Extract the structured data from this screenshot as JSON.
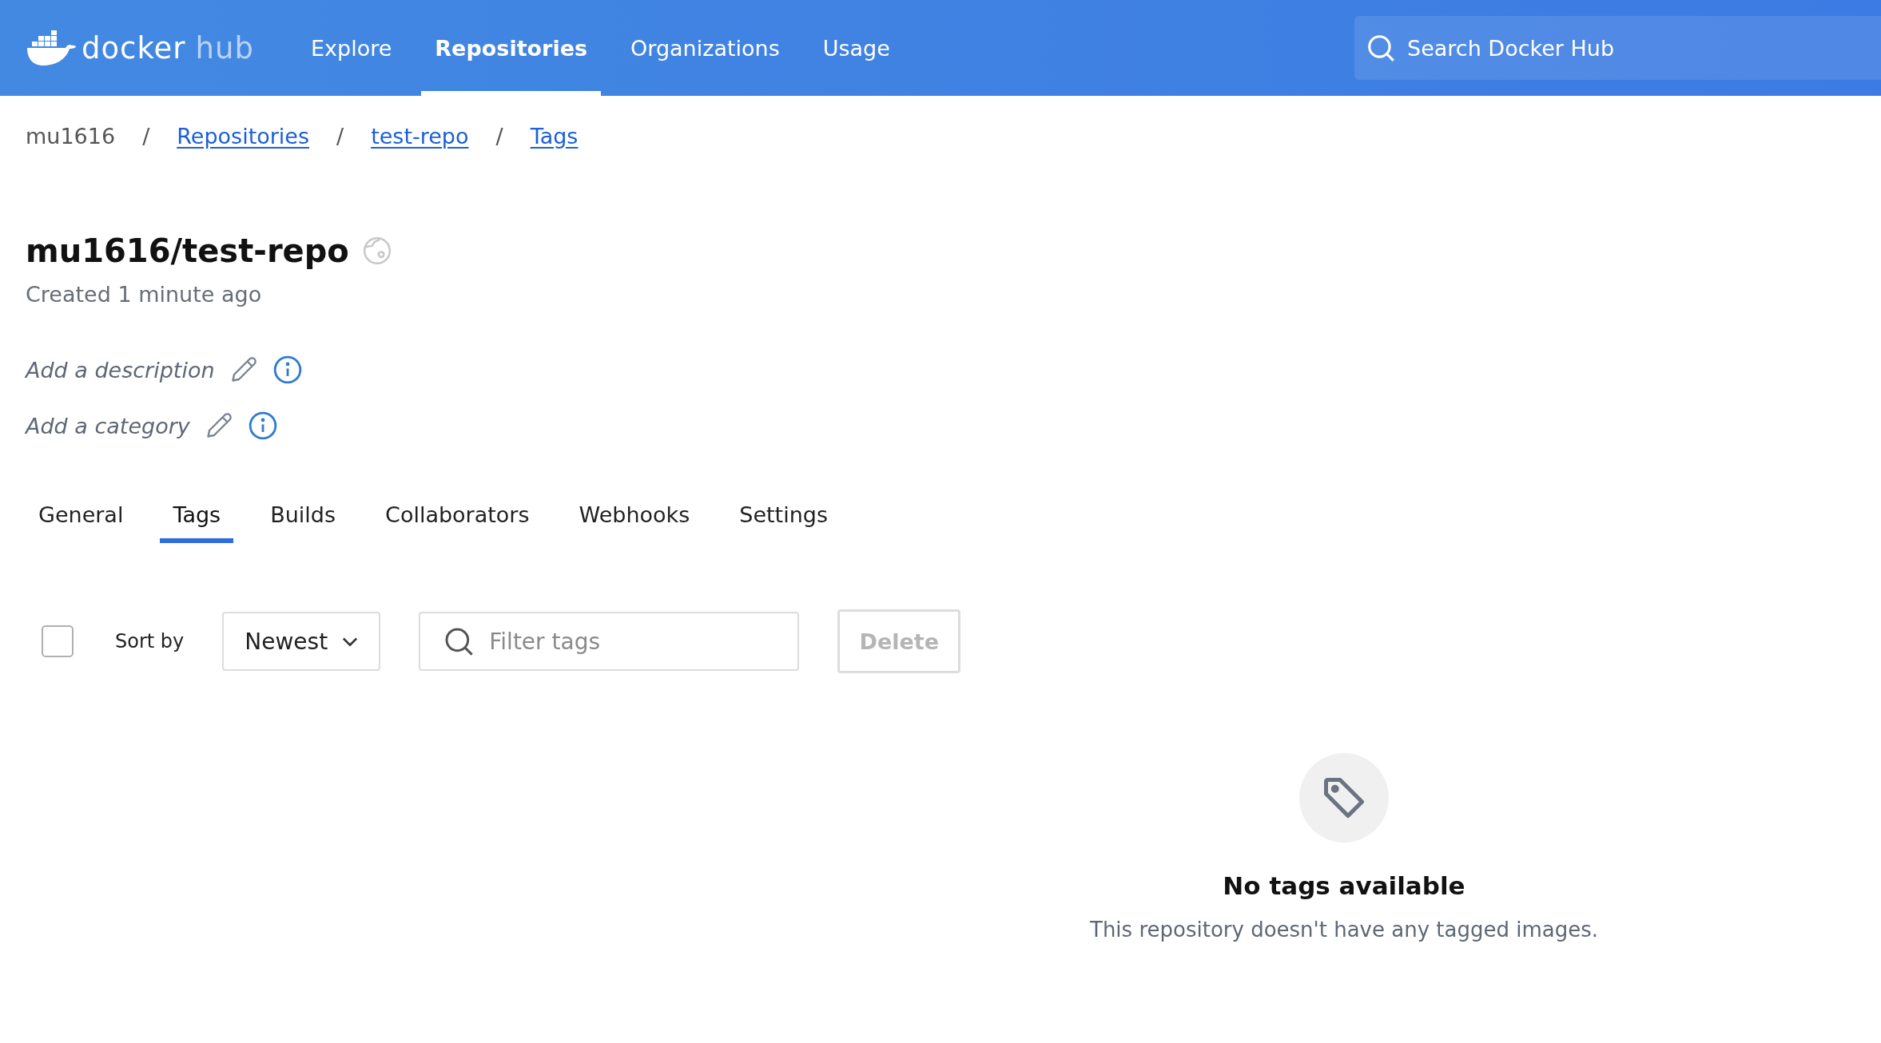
{
  "header": {
    "logo": {
      "primary": "docker",
      "secondary": "hub"
    },
    "nav": [
      {
        "label": "Explore",
        "selected": false
      },
      {
        "label": "Repositories",
        "selected": true
      },
      {
        "label": "Organizations",
        "selected": false
      },
      {
        "label": "Usage",
        "selected": false
      }
    ],
    "search": {
      "placeholder": "Search Docker Hub"
    }
  },
  "breadcrumb_separator": "/",
  "breadcrumb": [
    {
      "label": "mu1616",
      "link": false
    },
    {
      "label": "Repositories",
      "link": true
    },
    {
      "label": "test-repo",
      "link": true
    },
    {
      "label": "Tags",
      "link": true
    }
  ],
  "repo": {
    "title": "mu1616/test-repo",
    "created": "Created 1 minute ago",
    "fields": [
      {
        "label": "Add a description"
      },
      {
        "label": "Add a category"
      }
    ]
  },
  "tabs": [
    {
      "label": "General",
      "selected": false
    },
    {
      "label": "Tags",
      "selected": true
    },
    {
      "label": "Builds",
      "selected": false
    },
    {
      "label": "Collaborators",
      "selected": false
    },
    {
      "label": "Webhooks",
      "selected": false
    },
    {
      "label": "Settings",
      "selected": false
    }
  ],
  "toolbar": {
    "select_all": {
      "checked": false
    },
    "sort_label": "Sort by",
    "sort_value": "Newest",
    "filter": {
      "placeholder": "Filter tags"
    },
    "delete": {
      "label": "Delete",
      "disabled": true
    }
  },
  "empty_state": {
    "title": "No tags available",
    "message": "This repository doesn't have any tagged images."
  }
}
